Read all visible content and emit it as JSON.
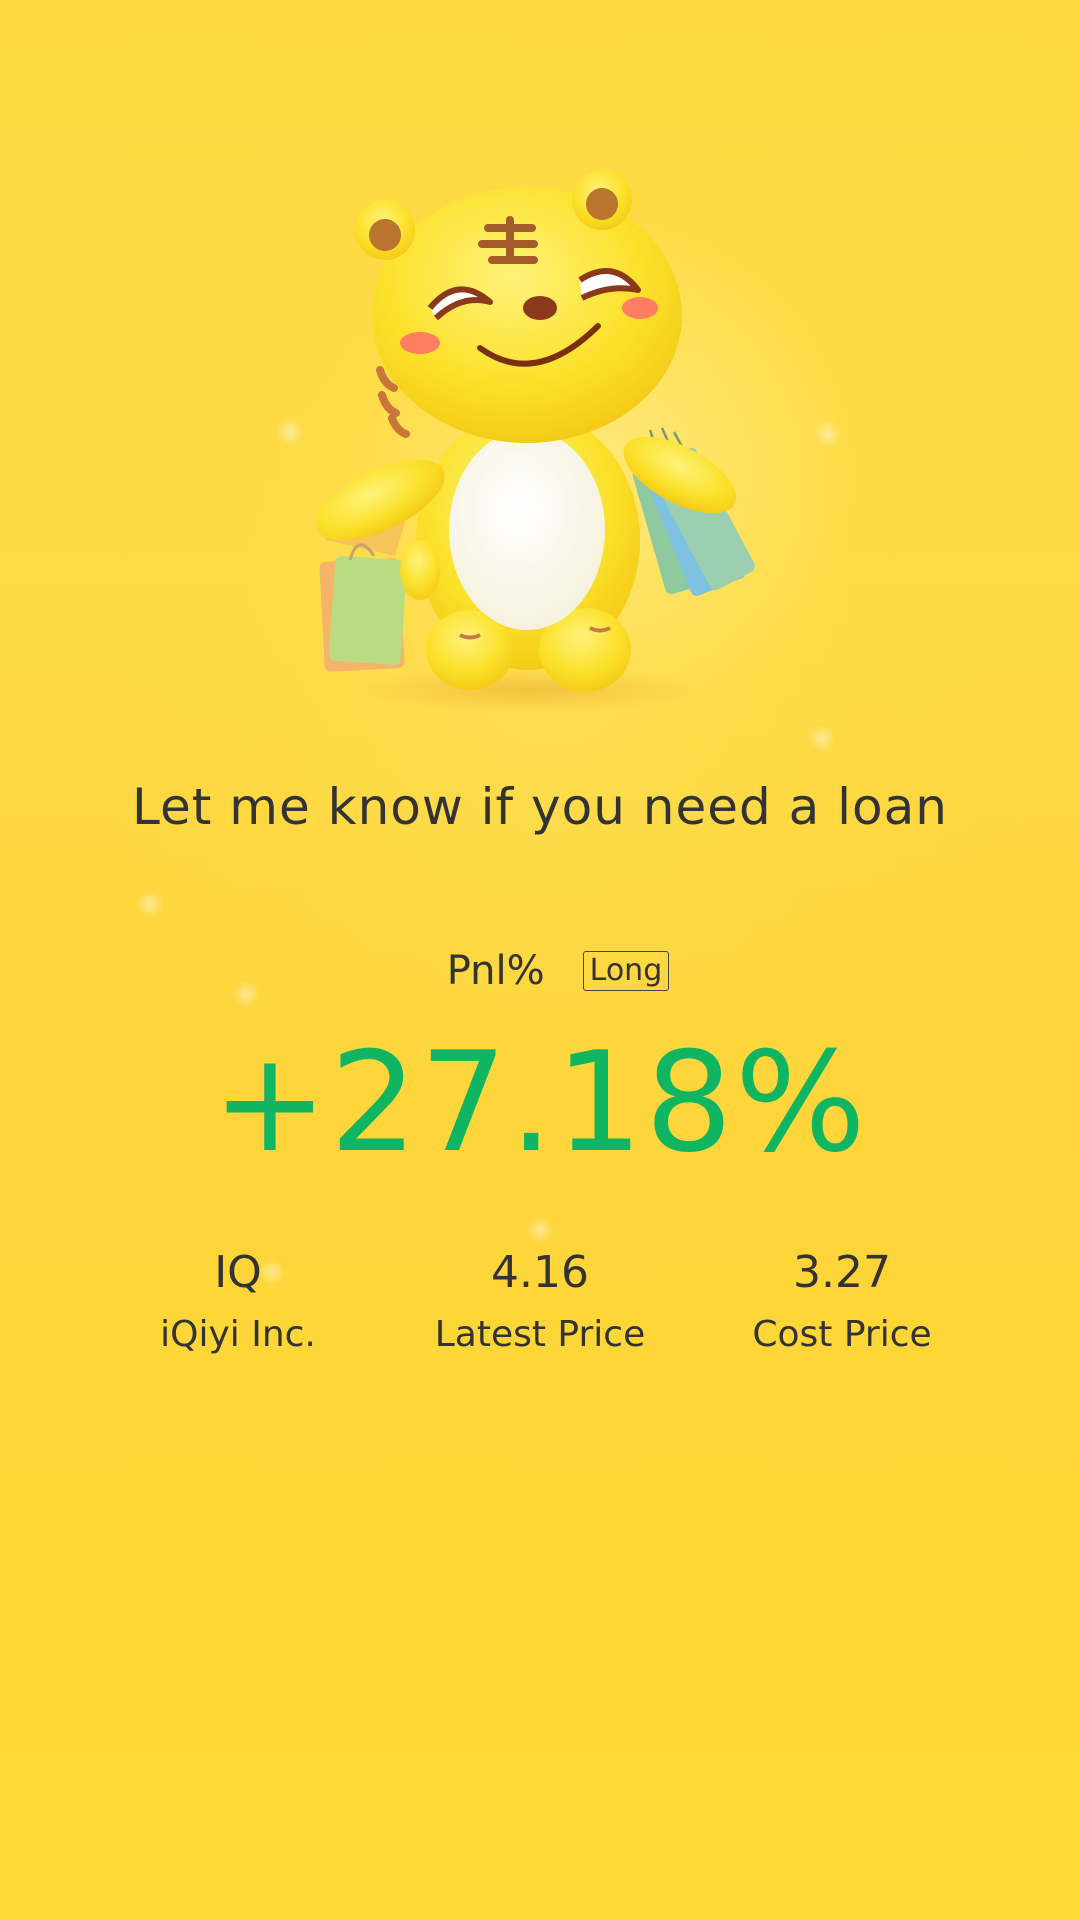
{
  "slogan": "Let me know if you need a loan",
  "pnl": {
    "label": "Pnl%",
    "tag": "Long",
    "value": "+27.18%"
  },
  "stats": {
    "ticker": "IQ",
    "company": "iQiyi Inc.",
    "latest_price": "4.16",
    "latest_price_label": "Latest Price",
    "cost_price": "3.27",
    "cost_price_label": "Cost Price"
  },
  "colors": {
    "background": "#fed93e",
    "gain": "#10b562",
    "text": "#333333"
  },
  "icons": {
    "mascot": "tiger-mascot-with-shopping-bags"
  }
}
